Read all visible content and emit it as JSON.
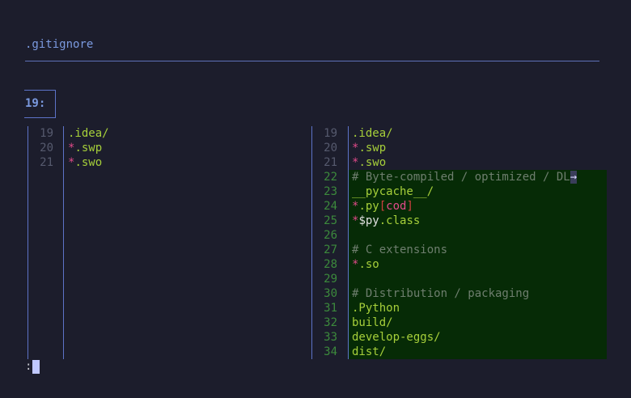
{
  "file": {
    "name": ".gitignore"
  },
  "hunk": {
    "label": "19:"
  },
  "left_pane": {
    "lines": [
      {
        "num": "19",
        "parts": [
          {
            "t": ".idea/",
            "c": "c-path"
          }
        ]
      },
      {
        "num": "20",
        "parts": [
          {
            "t": "*",
            "c": "c-star"
          },
          {
            "t": ".swp",
            "c": "c-path"
          }
        ]
      },
      {
        "num": "21",
        "parts": [
          {
            "t": "*",
            "c": "c-star"
          },
          {
            "t": ".swo",
            "c": "c-path"
          }
        ]
      }
    ]
  },
  "right_pane": {
    "lines": [
      {
        "num": "19",
        "added": false,
        "parts": [
          {
            "t": ".idea/",
            "c": "c-path"
          }
        ]
      },
      {
        "num": "20",
        "added": false,
        "parts": [
          {
            "t": "*",
            "c": "c-star"
          },
          {
            "t": ".swp",
            "c": "c-path"
          }
        ]
      },
      {
        "num": "21",
        "added": false,
        "parts": [
          {
            "t": "*",
            "c": "c-star"
          },
          {
            "t": ".swo",
            "c": "c-path"
          }
        ]
      },
      {
        "num": "22",
        "added": true,
        "parts": [
          {
            "t": "# Byte-compiled / optimized / DL",
            "c": "c-comment"
          },
          {
            "t": "→",
            "c": "arrow"
          }
        ]
      },
      {
        "num": "23",
        "added": true,
        "parts": [
          {
            "t": "__pycache__/",
            "c": "c-path"
          }
        ]
      },
      {
        "num": "24",
        "added": true,
        "parts": [
          {
            "t": "*",
            "c": "c-star"
          },
          {
            "t": ".py",
            "c": "c-path"
          },
          {
            "t": "[",
            "c": "c-bracket"
          },
          {
            "t": "cod",
            "c": "c-star"
          },
          {
            "t": "]",
            "c": "c-bracket"
          }
        ]
      },
      {
        "num": "25",
        "added": true,
        "parts": [
          {
            "t": "*",
            "c": "c-star"
          },
          {
            "t": "$py",
            "c": "c-dollar"
          },
          {
            "t": ".class",
            "c": "c-path"
          }
        ]
      },
      {
        "num": "26",
        "added": true,
        "parts": []
      },
      {
        "num": "27",
        "added": true,
        "parts": [
          {
            "t": "# C extensions",
            "c": "c-comment"
          }
        ]
      },
      {
        "num": "28",
        "added": true,
        "parts": [
          {
            "t": "*",
            "c": "c-star"
          },
          {
            "t": ".so",
            "c": "c-path"
          }
        ]
      },
      {
        "num": "29",
        "added": true,
        "parts": []
      },
      {
        "num": "30",
        "added": true,
        "parts": [
          {
            "t": "# Distribution / packaging",
            "c": "c-comment"
          }
        ]
      },
      {
        "num": "31",
        "added": true,
        "parts": [
          {
            "t": ".Python",
            "c": "c-path"
          }
        ]
      },
      {
        "num": "32",
        "added": true,
        "parts": [
          {
            "t": "build/",
            "c": "c-path"
          }
        ]
      },
      {
        "num": "33",
        "added": true,
        "parts": [
          {
            "t": "develop-eggs/",
            "c": "c-path"
          }
        ]
      },
      {
        "num": "34",
        "added": true,
        "parts": [
          {
            "t": "dist/",
            "c": "c-path"
          }
        ]
      }
    ]
  },
  "command_line": {
    "prompt": ":"
  },
  "colors": {
    "background": "#1c1d2c",
    "accent": "#5d73c8",
    "added_bg": "#062b06",
    "path": "#a6cf3a",
    "star": "#e24a8a",
    "comment": "#6e7e6e"
  }
}
